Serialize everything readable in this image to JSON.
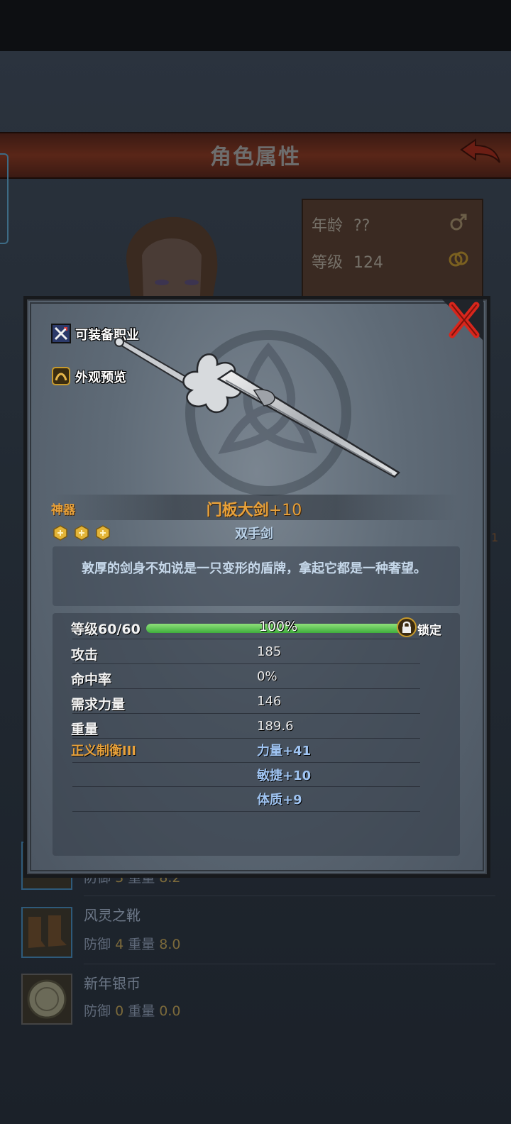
{
  "header": {
    "title": "角色属性"
  },
  "character": {
    "age_label": "年龄",
    "age_value": "??",
    "level_label": "等级",
    "level_value": "124"
  },
  "side_number": "1",
  "equipment_list": [
    {
      "name": "",
      "defense_label": "防御",
      "defense_value": "3",
      "weight_label": "重量",
      "weight_value": "8.2"
    },
    {
      "name": "风灵之靴",
      "defense_label": "防御",
      "defense_value": "4",
      "weight_label": "重量",
      "weight_value": "8.0"
    },
    {
      "name": "新年银币",
      "defense_label": "防御",
      "defense_value": "0",
      "weight_label": "重量",
      "weight_value": "0.0"
    }
  ],
  "item": {
    "equippable_jobs_label": "可装备职业",
    "appearance_preview_label": "外观预览",
    "rarity": "神器",
    "name": "门板大剑",
    "enhance": "+10",
    "type": "双手剑",
    "stars": 3,
    "description": "敦厚的剑身不如说是一只变形的盾牌，拿起它都是一种奢望。",
    "level_label": "等级60/60",
    "progress_percent": 100,
    "progress_text": "100%",
    "lock_label": "锁定",
    "stats": [
      {
        "label": "攻击",
        "value": "185"
      },
      {
        "label": "命中率",
        "value": "0%"
      },
      {
        "label": "需求力量",
        "value": "146"
      },
      {
        "label": "重量",
        "value": "189.6"
      }
    ],
    "set_bonus": {
      "label": "正义制衡III",
      "effects": [
        "力量+41",
        "敏捷+10",
        "体质+9"
      ]
    }
  },
  "colors": {
    "rarity_orange": "#e8a13a",
    "bonus_blue": "#9fc4f2",
    "progress_green": "#3fae3c",
    "close_red": "#d8261c"
  }
}
